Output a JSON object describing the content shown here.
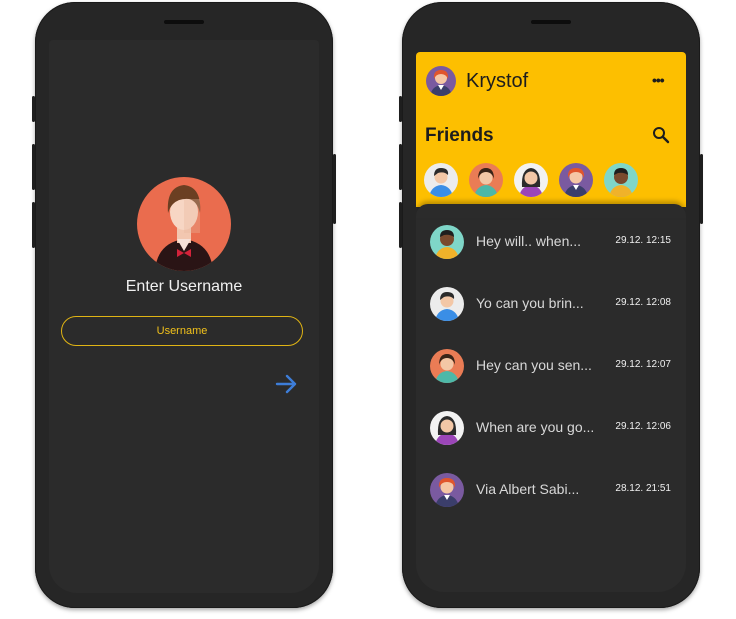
{
  "login": {
    "title": "Enter Username",
    "username_placeholder": "Username",
    "username_value": ""
  },
  "chat": {
    "header": {
      "user_name": "Krystof",
      "menu_label": "•••"
    },
    "friends_title": "Friends",
    "friends": [
      "boy-avatar-icon",
      "girl-avatar-icon",
      "woman-avatar-icon",
      "redhead-avatar-icon",
      "man-avatar-icon"
    ],
    "conversations": [
      {
        "preview": "Hey will.. when...",
        "time": "29.12. 12:15"
      },
      {
        "preview": "Yo can you brin...",
        "time": "29.12. 12:08"
      },
      {
        "preview": "Hey can you sen...",
        "time": "29.12. 12:07"
      },
      {
        "preview": "When are you go...",
        "time": "29.12. 12:06"
      },
      {
        "preview": "Via Albert Sabi...",
        "time": "28.12. 21:51"
      }
    ]
  },
  "colors": {
    "accent": "#fdbf00",
    "screen_bg": "#2b2b2b",
    "phone_body": "#262626",
    "arrow": "#3d7dd8"
  }
}
